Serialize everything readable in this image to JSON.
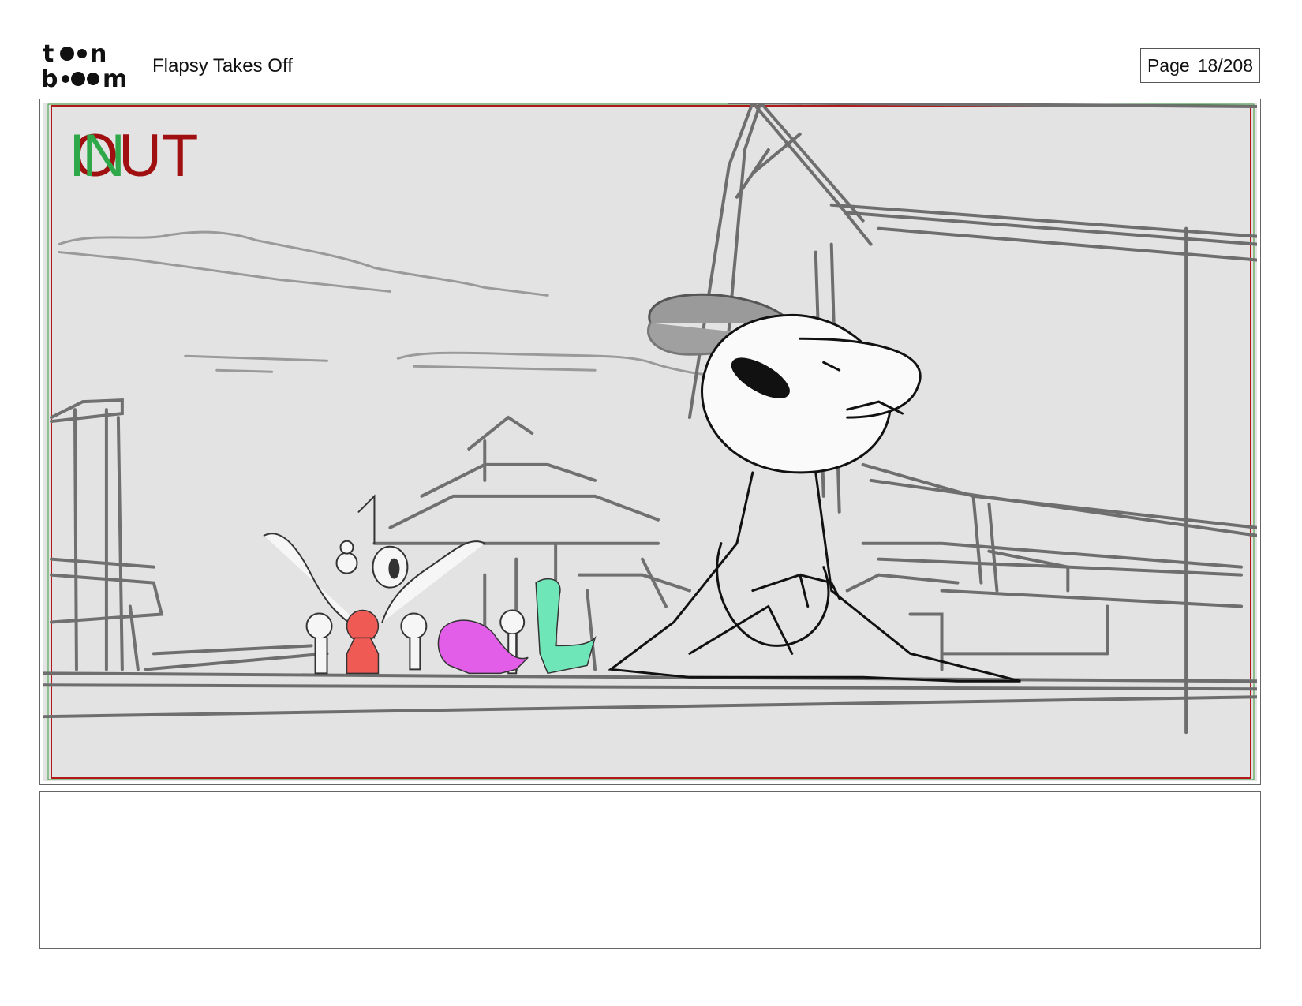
{
  "header": {
    "title": "Flapsy Takes Off",
    "page_label": "Page",
    "page_number": "18/208"
  },
  "logo": {
    "icon": "toonboom-logo-icon",
    "text_line1": "toon",
    "text_line2": "boom"
  },
  "panel": {
    "marker_in": "IN",
    "marker_out": "OUT"
  },
  "colors": {
    "in_marker": "#2fa84a",
    "out_marker": "#a01010",
    "safe_frame_red": "#b01818",
    "safe_frame_green": "#3a9a3a",
    "character_red": "#ef5a55",
    "character_magenta": "#e35ee8",
    "character_teal": "#6ee6b8"
  },
  "notes": {
    "text": ""
  }
}
